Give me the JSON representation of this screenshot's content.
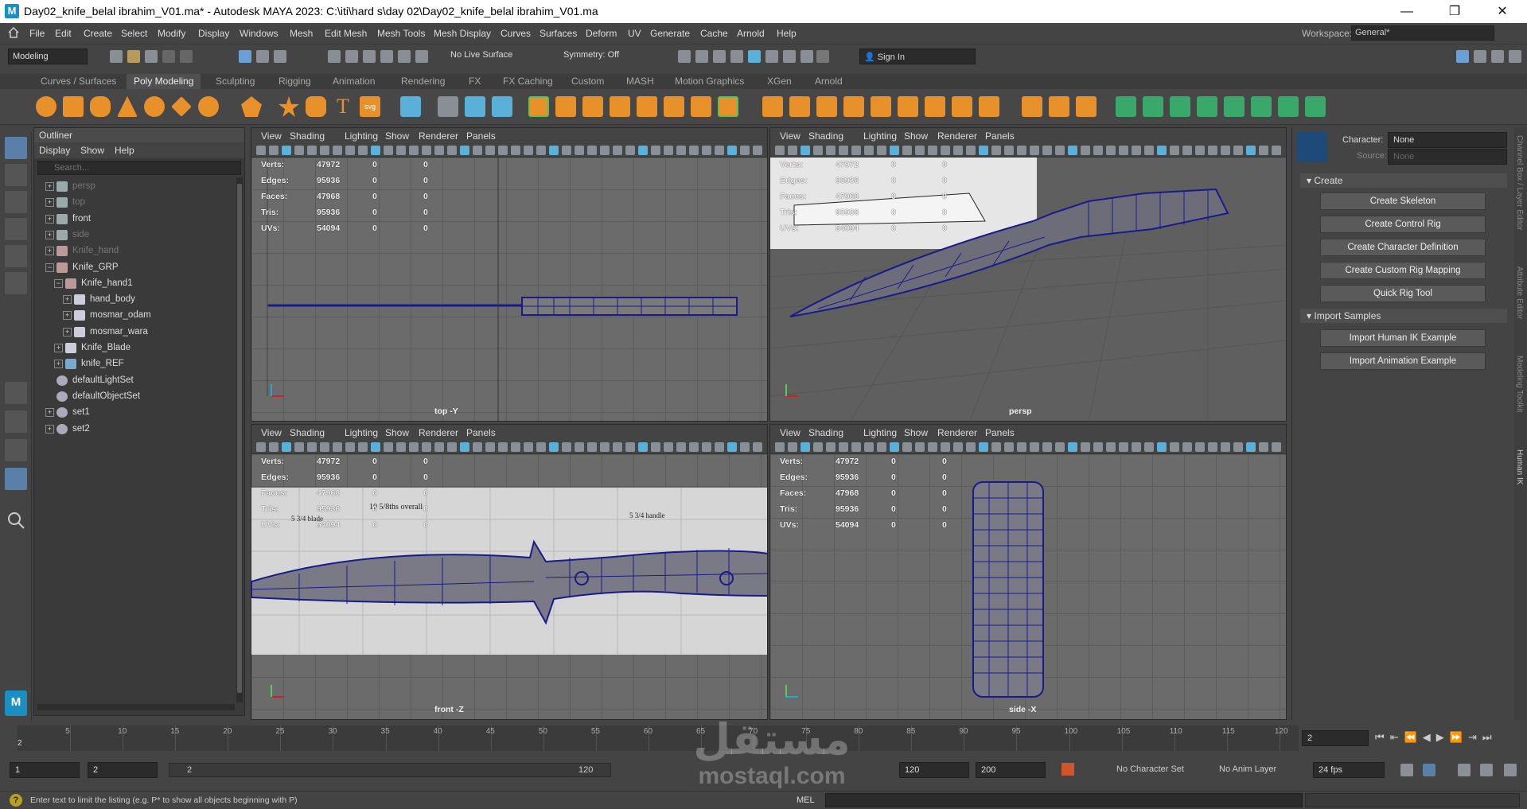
{
  "window": {
    "title": "Day02_knife_belal ibrahim_V01.ma* - Autodesk MAYA 2023: C:\\iti\\hard s\\day 02\\Day02_knife_belal ibrahim_V01.ma",
    "logo": "M",
    "minimize": "—",
    "maximize": "❐",
    "close": "✕"
  },
  "menubar": {
    "items": [
      "File",
      "Edit",
      "Create",
      "Select",
      "Modify",
      "Display",
      "Windows",
      "Mesh",
      "Edit Mesh",
      "Mesh Tools",
      "Mesh Display",
      "Curves",
      "Surfaces",
      "Deform",
      "UV",
      "Generate",
      "Cache",
      "Arnold",
      "Help"
    ],
    "workspace_label": "Workspace:",
    "workspace_value": "General*"
  },
  "statusline": {
    "menuset": "Modeling",
    "live_surface": "No Live Surface",
    "symmetry": "Symmetry: Off",
    "sign_in": "Sign In"
  },
  "shelf": {
    "tabs": [
      "Curves / Surfaces",
      "Poly Modeling",
      "Sculpting",
      "Rigging",
      "Animation",
      "Rendering",
      "FX",
      "FX Caching",
      "Custom",
      "MASH",
      "Motion Graphics",
      "XGen",
      "Arnold"
    ],
    "active_tab": "Poly Modeling"
  },
  "outliner": {
    "title": "Outliner",
    "menu": [
      "Display",
      "Show",
      "Help"
    ],
    "search_placeholder": "Search...",
    "rows": [
      {
        "label": "persp",
        "indent": 0,
        "icon": "camera-icon",
        "dim": true,
        "exp": "+"
      },
      {
        "label": "top",
        "indent": 0,
        "icon": "camera-icon",
        "dim": true,
        "exp": "+"
      },
      {
        "label": "front",
        "indent": 0,
        "icon": "camera-icon",
        "dim": false,
        "exp": "+"
      },
      {
        "label": "side",
        "indent": 0,
        "icon": "camera-icon",
        "dim": true,
        "exp": "+"
      },
      {
        "label": "Knife_hand",
        "indent": 0,
        "icon": "curve-icon",
        "dim": true,
        "exp": "+"
      },
      {
        "label": "Knife_GRP",
        "indent": 0,
        "icon": "curve-icon",
        "dim": false,
        "exp": "−"
      },
      {
        "label": "Knife_hand1",
        "indent": 1,
        "icon": "curve-icon",
        "dim": false,
        "exp": "−"
      },
      {
        "label": "hand_body",
        "indent": 2,
        "icon": "mesh-icon",
        "dim": false,
        "exp": "+"
      },
      {
        "label": "mosmar_odam",
        "indent": 2,
        "icon": "mesh-icon",
        "dim": false,
        "exp": "+"
      },
      {
        "label": "mosmar_wara",
        "indent": 2,
        "icon": "mesh-icon",
        "dim": false,
        "exp": "+"
      },
      {
        "label": "Knife_Blade",
        "indent": 1,
        "icon": "mesh-icon",
        "dim": false,
        "exp": "+"
      },
      {
        "label": "knife_REF",
        "indent": 1,
        "icon": "image-plane-icon",
        "dim": false,
        "exp": "+"
      },
      {
        "label": "defaultLightSet",
        "indent": 0,
        "icon": "set-icon",
        "dim": false,
        "exp": ""
      },
      {
        "label": "defaultObjectSet",
        "indent": 0,
        "icon": "set-icon",
        "dim": false,
        "exp": ""
      },
      {
        "label": "set1",
        "indent": 0,
        "icon": "set-icon",
        "dim": false,
        "exp": "+"
      },
      {
        "label": "set2",
        "indent": 0,
        "icon": "set-icon",
        "dim": false,
        "exp": "+"
      }
    ]
  },
  "viewport_menu": [
    "View",
    "Shading",
    "Lighting",
    "Show",
    "Renderer",
    "Panels"
  ],
  "hud": {
    "labels": [
      "Verts:",
      "Edges:",
      "Faces:",
      "Tris:",
      "UVs:"
    ],
    "values": [
      "47972",
      "95936",
      "47968",
      "95936",
      "54094"
    ],
    "zero": "0"
  },
  "viewports": {
    "top": "top -Y",
    "persp": "persp",
    "front": "front -Z",
    "side": "side -X"
  },
  "reference_text": {
    "overall": "10 5/8ths overall",
    "blade": "5 3/4 blade",
    "handle": "5 3/4 handle"
  },
  "channel": {
    "character_label": "Character:",
    "character_value": "None",
    "source_label": "Source:",
    "source_value": "None",
    "create_header": "Create",
    "create_buttons": [
      "Create Skeleton",
      "Create Control Rig",
      "Create Character Definition",
      "Create Custom Rig Mapping",
      "Quick Rig Tool"
    ],
    "import_header": "Import Samples",
    "import_buttons": [
      "Import Human IK Example",
      "Import Animation Example"
    ]
  },
  "sidetabs": [
    "Channel Box / Layer Editor",
    "Attribute Editor",
    "Modeling Toolkit",
    "Human IK"
  ],
  "timeslider": {
    "ticks": [
      "5",
      "10",
      "15",
      "20",
      "25",
      "30",
      "35",
      "40",
      "45",
      "50",
      "55",
      "60",
      "65",
      "70",
      "75",
      "80",
      "85",
      "90",
      "95",
      "100",
      "105",
      "110",
      "115",
      "120"
    ],
    "current_frame_marker": "2",
    "current_frame": "2"
  },
  "range": {
    "start": "1",
    "playback_start": "2",
    "slider_start": "2",
    "slider_end": "120",
    "end": "120",
    "anim_end": "200",
    "character_set": "No Character Set",
    "anim_layer": "No Anim Layer",
    "fps": "24 fps"
  },
  "helpline": {
    "text": "Enter text to limit the listing (e.g. P* to show all objects beginning with P)",
    "mel": "MEL"
  },
  "watermark": {
    "arabic": "مستقل",
    "latin": "mostaql.com"
  },
  "colors": {
    "accent": "#1a8fc2",
    "wire": "#1a1a8a",
    "shelf_orange": "#e8912a"
  }
}
